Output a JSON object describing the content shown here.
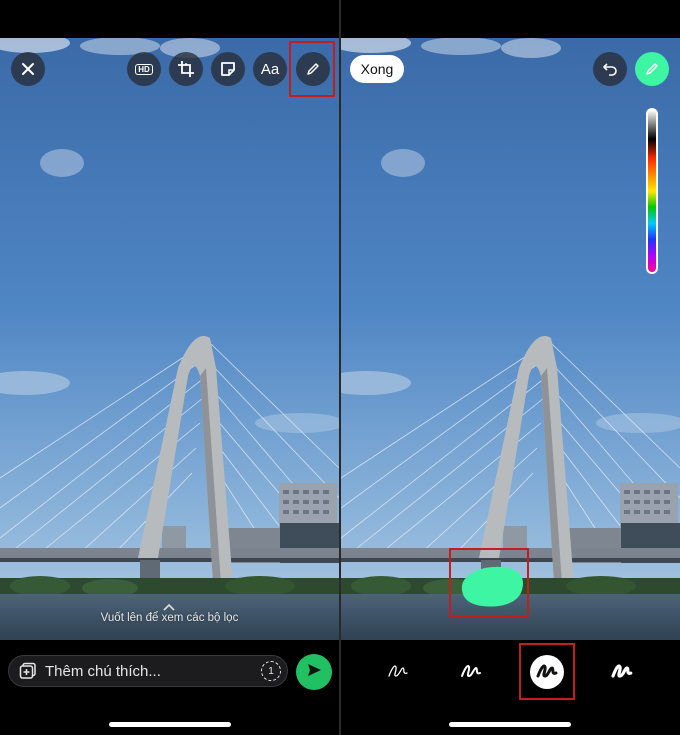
{
  "left_panel": {
    "toolbar": {
      "close_icon": "close-icon",
      "hd_label": "HD",
      "crop_icon": "crop-rotate-icon",
      "sticker_icon": "sticker-icon",
      "text_label": "Aa",
      "draw_icon": "pencil-icon"
    },
    "hint_text": "Vuốt lên để xem các bộ lọc",
    "caption": {
      "placeholder": "Thêm chú thích...",
      "view_once_label": "1"
    },
    "send_icon": "send-icon"
  },
  "right_panel": {
    "done_label": "Xong",
    "undo_icon": "undo-icon",
    "draw_icon": "pencil-icon",
    "brush_color": "#3ef5a3",
    "pens": [
      {
        "name": "thin-pen",
        "active": false
      },
      {
        "name": "medium-pen",
        "active": false
      },
      {
        "name": "thick-pen",
        "active": true
      },
      {
        "name": "neon-pen",
        "active": false
      }
    ]
  },
  "colors": {
    "accent_green": "#21c063",
    "highlight_red": "#c0201d"
  }
}
